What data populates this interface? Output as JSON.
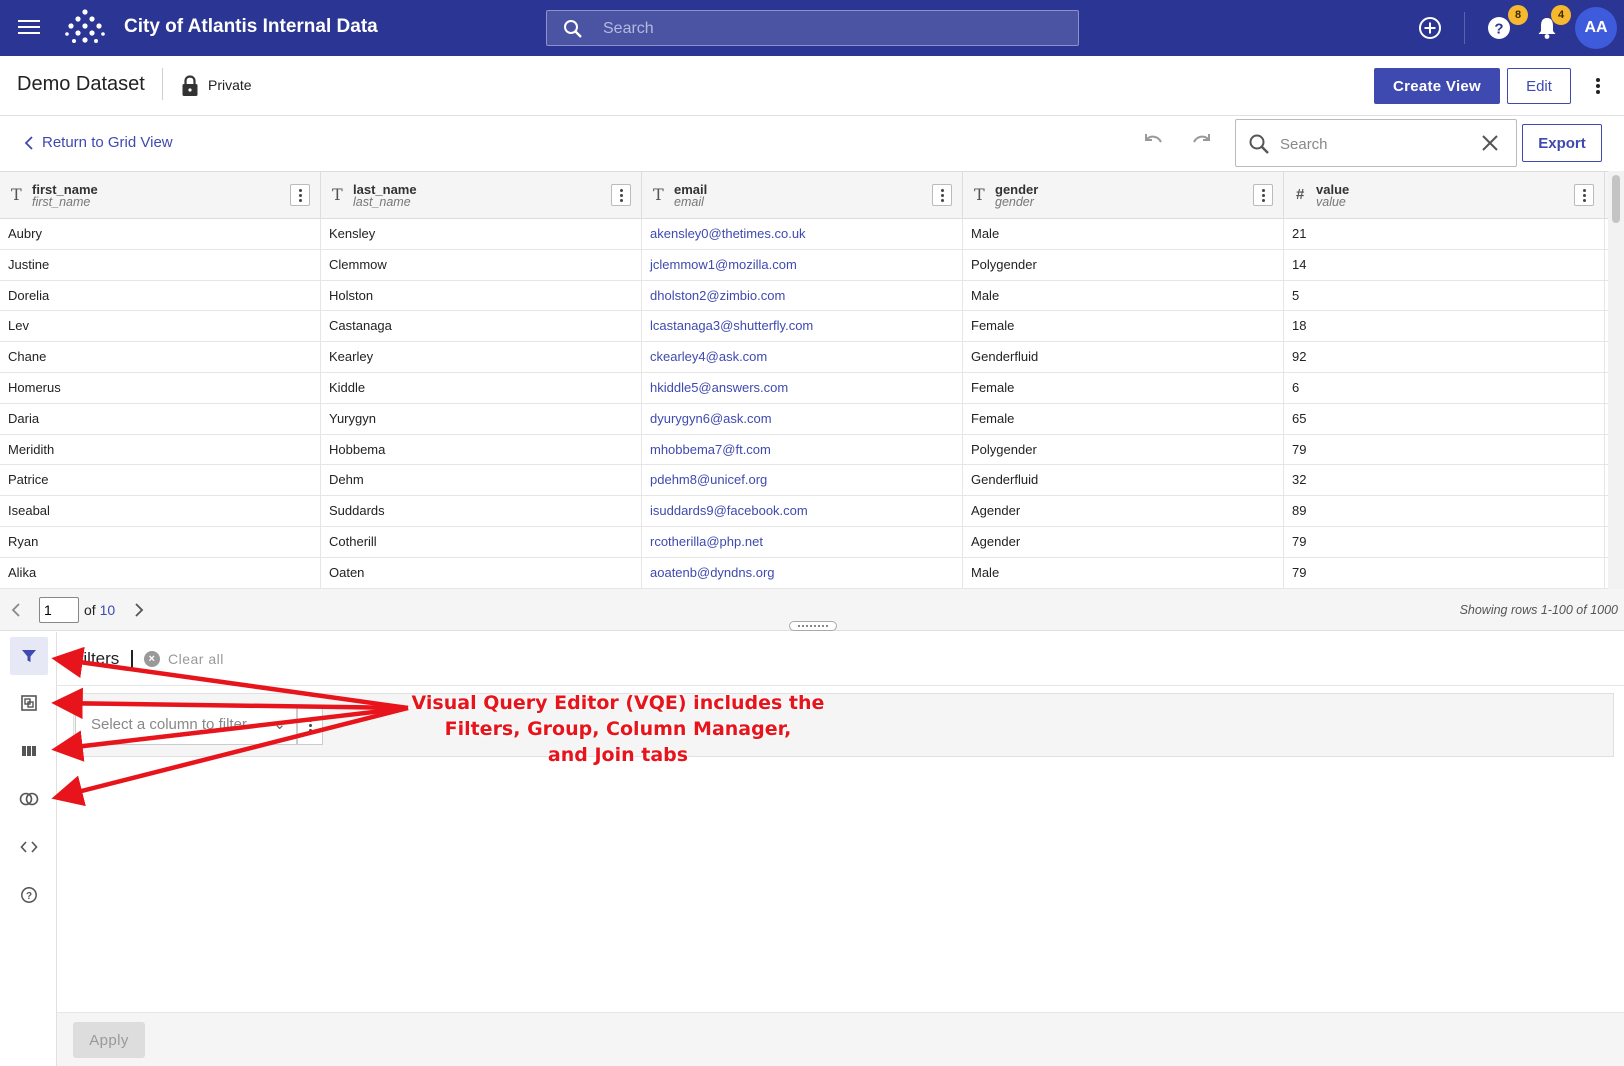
{
  "app": {
    "title": "City of Atlantis Internal Data",
    "search_placeholder": "Search",
    "help_badge": "8",
    "notification_badge": "4",
    "avatar_initials": "AA"
  },
  "dataset": {
    "title": "Demo Dataset",
    "visibility": "Private",
    "create_view_label": "Create View",
    "edit_label": "Edit"
  },
  "toolbar": {
    "back_label": "Return to Grid View",
    "search_placeholder": "Search",
    "export_label": "Export"
  },
  "grid": {
    "columns": [
      {
        "name": "first_name",
        "field": "first_name",
        "type_icon": "text-type-icon"
      },
      {
        "name": "last_name",
        "field": "last_name",
        "type_icon": "text-type-icon"
      },
      {
        "name": "email",
        "field": "email",
        "type_icon": "text-type-icon"
      },
      {
        "name": "gender",
        "field": "gender",
        "type_icon": "text-type-icon"
      },
      {
        "name": "value",
        "field": "value",
        "type_icon": "number-type-icon"
      }
    ],
    "rows": [
      [
        "Aubry",
        "Kensley",
        "akensley0@thetimes.co.uk",
        "Male",
        "21"
      ],
      [
        "Justine",
        "Clemmow",
        "jclemmow1@mozilla.com",
        "Polygender",
        "14"
      ],
      [
        "Dorelia",
        "Holston",
        "dholston2@zimbio.com",
        "Male",
        "5"
      ],
      [
        "Lev",
        "Castanaga",
        "lcastanaga3@shutterfly.com",
        "Female",
        "18"
      ],
      [
        "Chane",
        "Kearley",
        "ckearley4@ask.com",
        "Genderfluid",
        "92"
      ],
      [
        "Homerus",
        "Kiddle",
        "hkiddle5@answers.com",
        "Female",
        "6"
      ],
      [
        "Daria",
        "Yurygyn",
        "dyurygyn6@ask.com",
        "Female",
        "65"
      ],
      [
        "Meridith",
        "Hobbema",
        "mhobbema7@ft.com",
        "Polygender",
        "79"
      ],
      [
        "Patrice",
        "Dehm",
        "pdehm8@unicef.org",
        "Genderfluid",
        "32"
      ],
      [
        "Iseabal",
        "Suddards",
        "isuddards9@facebook.com",
        "Agender",
        "89"
      ],
      [
        "Ryan",
        "Cotherill",
        "rcotherilla@php.net",
        "Agender",
        "79"
      ],
      [
        "Alika",
        "Oaten",
        "aoatenb@dyndns.org",
        "Male",
        "79"
      ]
    ]
  },
  "pager": {
    "page": "1",
    "of_label": "of",
    "total_pages": "10",
    "showing": "Showing rows 1-100 of 1000"
  },
  "vqe": {
    "filters_title": "Filters",
    "clear_all_label": "Clear all",
    "column_select_placeholder": "Select a column to filter",
    "apply_label": "Apply",
    "tabs": [
      "filter-icon",
      "group-icon",
      "column-manager-icon",
      "join-icon",
      "code-icon",
      "help-circle-icon"
    ]
  },
  "annotation": {
    "lines": [
      "Visual Query Editor (VQE) includes the",
      "Filters, Group, Column Manager,",
      "and Join tabs"
    ],
    "color": "#e8141b"
  },
  "colors": {
    "appbar": "#2b3593",
    "accent": "#3f4ab0",
    "badge": "#f5b82e"
  }
}
